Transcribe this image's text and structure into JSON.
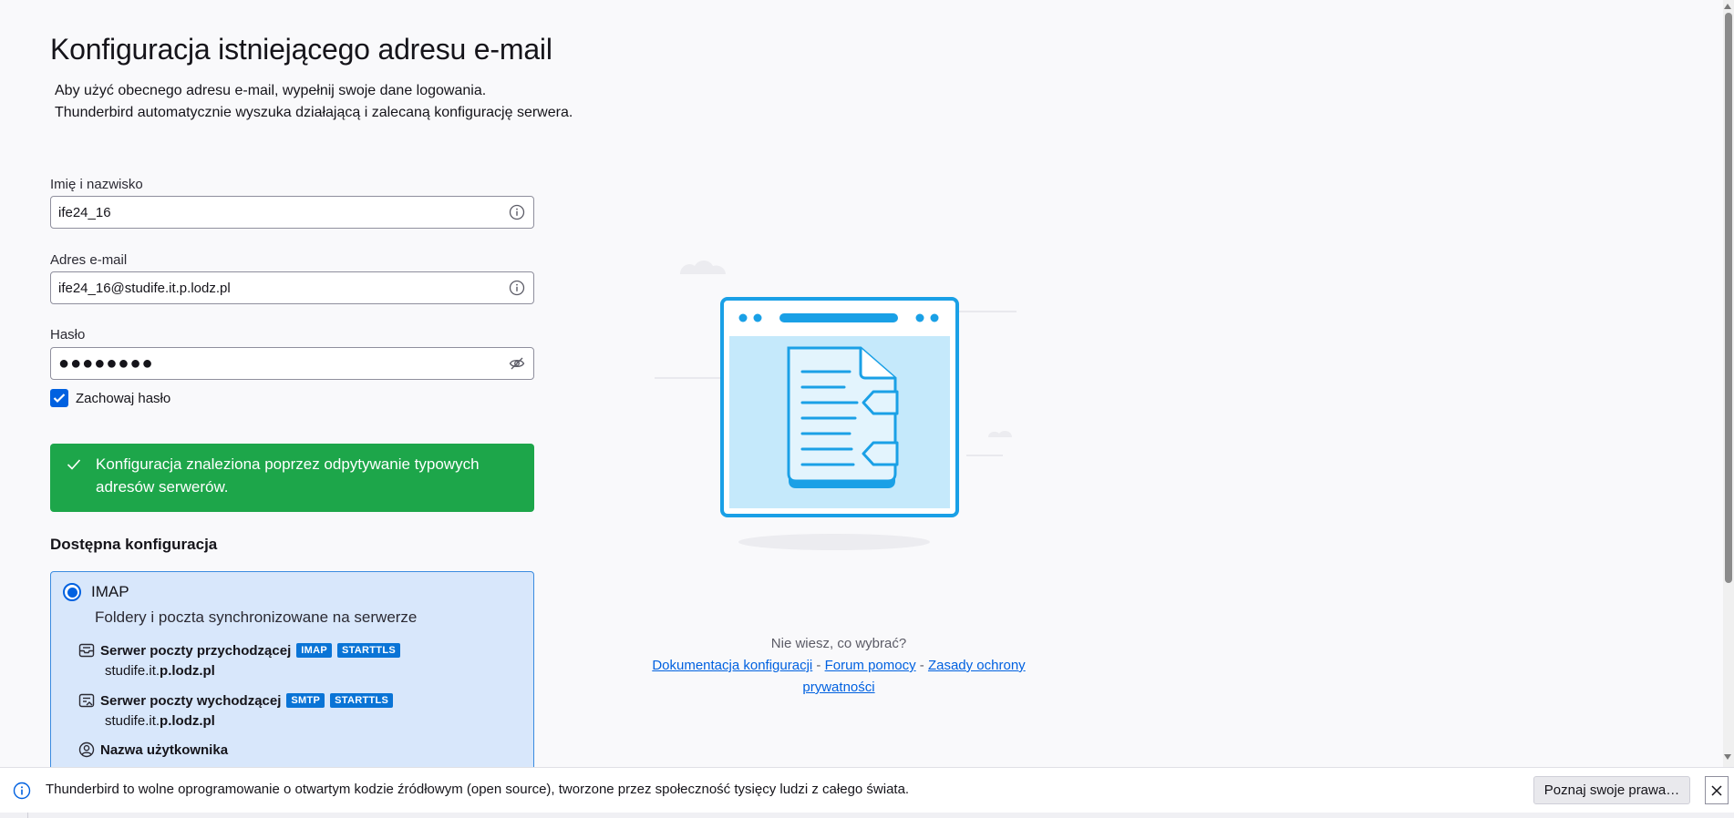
{
  "page": {
    "title": "Konfiguracja istniejącego adresu e-mail",
    "intro_line1": "Aby użyć obecnego adresu e-mail, wypełnij swoje dane logowania.",
    "intro_line2": "Thunderbird automatycznie wyszuka działającą i zalecaną konfigurację serwera."
  },
  "form": {
    "name_label": "Imię i nazwisko",
    "name_value": "ife24_16",
    "email_label": "Adres e-mail",
    "email_value": "ife24_16@studife.it.p.lodz.pl",
    "password_label": "Hasło",
    "password_value": "●●●●●●●●",
    "remember_label": "Zachowaj hasło",
    "remember_checked": true
  },
  "status": {
    "message": "Konfiguracja znaleziona poprzez odpytywanie typowych adresów serwerów."
  },
  "config": {
    "section_title": "Dostępna konfiguracja",
    "protocol": "IMAP",
    "description": "Foldery i poczta synchronizowane na serwerze",
    "incoming_title": "Serwer poczty przychodzącej",
    "incoming_badge1": "IMAP",
    "incoming_badge2": "STARTTLS",
    "incoming_host_prefix": "studife.it.",
    "incoming_host_bold": "p.lodz.pl",
    "outgoing_title": "Serwer poczty wychodzącej",
    "outgoing_badge1": "SMTP",
    "outgoing_badge2": "STARTTLS",
    "outgoing_host_prefix": "studife.it.",
    "outgoing_host_bold": "p.lodz.pl",
    "username_title": "Nazwa użytkownika"
  },
  "help": {
    "question": "Nie wiesz, co wybrać?",
    "link1": "Dokumentacja konfiguracji",
    "link2": "Forum pomocy",
    "link3": "Zasady ochrony prywatności",
    "separator": "-"
  },
  "notification": {
    "text": "Thunderbird to wolne oprogramowanie o otwartym kodzie źródłowym (open source), tworzone przez społeczność tysięcy ludzi z całego świata.",
    "button": "Poznaj swoje prawa…"
  },
  "colors": {
    "success": "#1da64a",
    "accent": "#0061e0",
    "badge": "#0a74d6",
    "config_bg": "#d8e7fb"
  }
}
